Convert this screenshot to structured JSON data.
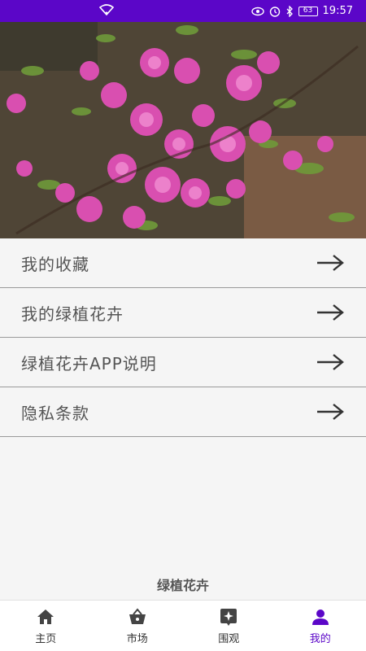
{
  "status_bar": {
    "time": "19:57",
    "battery": "63",
    "icons": [
      "wifi-icon",
      "eye-icon",
      "alarm-icon",
      "bluetooth-icon",
      "battery-icon"
    ]
  },
  "hero": {
    "image": "pink-flowering-branch-photo"
  },
  "menu": {
    "items": [
      {
        "label": "我的收藏",
        "icon": "arrow-right-icon"
      },
      {
        "label": "我的绿植花卉",
        "icon": "arrow-right-icon"
      },
      {
        "label": "绿植花卉APP说明",
        "icon": "arrow-right-icon"
      },
      {
        "label": "隐私条款",
        "icon": "arrow-right-icon"
      }
    ]
  },
  "app_name": "绿植花卉",
  "tabs": [
    {
      "label": "主页",
      "icon": "home-icon",
      "active": false
    },
    {
      "label": "市场",
      "icon": "basket-icon",
      "active": false
    },
    {
      "label": "围观",
      "icon": "sparkle-icon",
      "active": false
    },
    {
      "label": "我的",
      "icon": "person-icon",
      "active": true
    }
  ],
  "colors": {
    "accent": "#5b06c8",
    "background": "#f5f5f5",
    "text": "#555555"
  }
}
